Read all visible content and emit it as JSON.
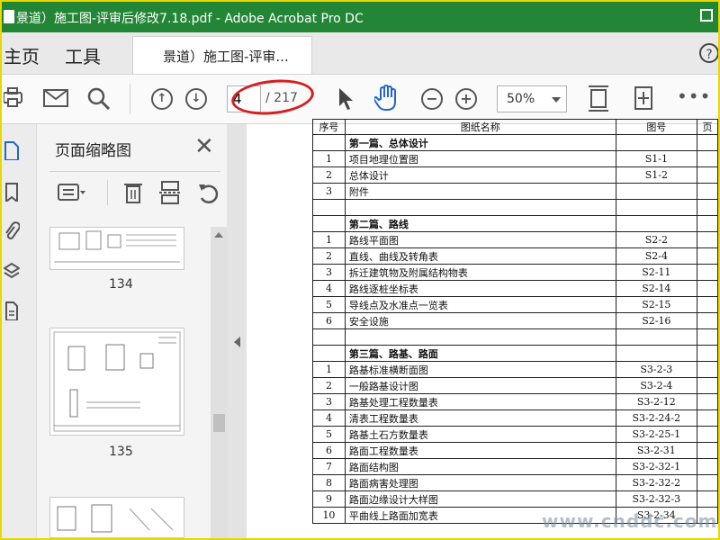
{
  "window": {
    "title": "景道）施工图-评审后修改7.18.pdf - Adobe Acrobat Pro DC"
  },
  "tabs": {
    "home": "主页",
    "tools": "工具",
    "document": "景道）施工图-评审..."
  },
  "toolbar": {
    "current_page": "4",
    "total_pages": "/ 217",
    "zoom": "50%",
    "icons": [
      "print-icon",
      "mail-icon",
      "search-icon",
      "page-up-icon",
      "page-down-icon",
      "select-cursor-icon",
      "hand-tool-icon",
      "zoom-out-icon",
      "zoom-in-icon",
      "fit-page-icon",
      "rotate-view-icon",
      "more-icon"
    ]
  },
  "thumbnails": {
    "panel_title": "页面缩略图",
    "pages": [
      {
        "label": "134"
      },
      {
        "label": "135"
      }
    ]
  },
  "table": {
    "headers": [
      "序号",
      "图纸名称",
      "图号",
      "页"
    ],
    "rows": [
      {
        "no": "",
        "name": "第一篇、总体设计",
        "code": "",
        "section": true
      },
      {
        "no": "1",
        "name": "项目地理位置图",
        "code": "S1-1"
      },
      {
        "no": "2",
        "name": "总体设计",
        "code": "S1-2"
      },
      {
        "no": "3",
        "name": "附件",
        "code": ""
      },
      {
        "no": "",
        "name": "",
        "code": ""
      },
      {
        "no": "",
        "name": "第二篇、路线",
        "code": "",
        "section": true
      },
      {
        "no": "1",
        "name": "路线平面图",
        "code": "S2-2"
      },
      {
        "no": "2",
        "name": "直线、曲线及转角表",
        "code": "S2-4"
      },
      {
        "no": "3",
        "name": "拆迁建筑物及附属结构物表",
        "code": "S2-11"
      },
      {
        "no": "4",
        "name": "路线逐桩坐标表",
        "code": "S2-14"
      },
      {
        "no": "5",
        "name": "导线点及水准点一览表",
        "code": "S2-15"
      },
      {
        "no": "6",
        "name": "安全设施",
        "code": "S2-16"
      },
      {
        "no": "",
        "name": "",
        "code": ""
      },
      {
        "no": "",
        "name": "第三篇、路基、路面",
        "code": "",
        "section": true
      },
      {
        "no": "1",
        "name": "路基标准横断面图",
        "code": "S3-2-3"
      },
      {
        "no": "2",
        "name": "一般路基设计图",
        "code": "S3-2-4"
      },
      {
        "no": "3",
        "name": "路基处理工程数量表",
        "code": "S3-2-12"
      },
      {
        "no": "4",
        "name": "清表工程数量表",
        "code": "S3-2-24-2"
      },
      {
        "no": "5",
        "name": "路基土石方数量表",
        "code": "S3-2-25-1"
      },
      {
        "no": "6",
        "name": "路面工程数量表",
        "code": "S3-2-31"
      },
      {
        "no": "7",
        "name": "路面结构图",
        "code": "S3-2-32-1"
      },
      {
        "no": "8",
        "name": "路面病害处理图",
        "code": "S3-2-32-2"
      },
      {
        "no": "9",
        "name": "路面边缘设计大样图",
        "code": "S3-2-32-3"
      },
      {
        "no": "10",
        "name": "平曲线上路面加宽表",
        "code": "S3-2-34"
      }
    ]
  },
  "watermark": "www.cnddc.com",
  "colors": {
    "titlebar": "#238636",
    "highlight": "#d42020",
    "frame": "#e8d800",
    "hand_tool": "#2266cc"
  }
}
